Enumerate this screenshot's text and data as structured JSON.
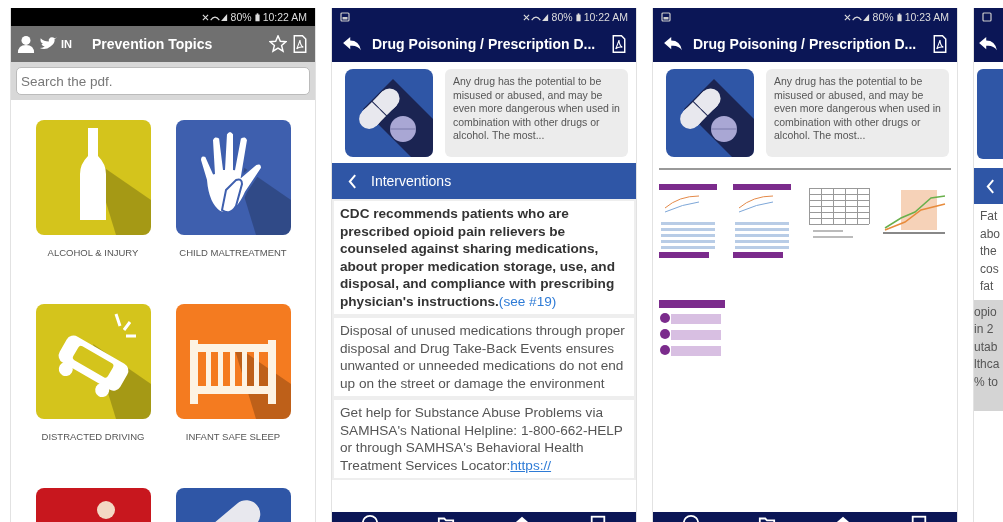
{
  "phones": [
    {
      "kind": "topics",
      "status": {
        "battery": "80%",
        "time": "10:22 AM"
      },
      "header": {
        "logo": "IN",
        "title": "Prevention Topics"
      },
      "search": {
        "placeholder": "Search the pdf."
      },
      "topics": [
        {
          "kind": "bottle",
          "color": "#d4c41c",
          "label": "ALCOHOL & INJURY"
        },
        {
          "kind": "hand",
          "color": "#3e5fae",
          "label": "CHILD MALTREATMENT"
        },
        {
          "kind": "car",
          "color": "#d4c41c",
          "label": "DISTRACTED DRIVING"
        },
        {
          "kind": "crib",
          "color": "#f47b20",
          "label": "INFANT SAFE SLEEP"
        },
        {
          "kind": "person",
          "color": "#c8171e"
        },
        {
          "kind": "pill",
          "color": "#2f56a6"
        }
      ]
    },
    {
      "kind": "interventions",
      "status": {
        "battery": "80%",
        "time": "10:22 AM"
      },
      "header": {
        "title": "Drug Poisoning / Prescription D..."
      },
      "summary": "Any drug has the potential to be misused or abused, and may be even more dangerous when used in combination with other drugs or alcohol. The most...",
      "section": "Interventions",
      "cards": [
        {
          "bold": true,
          "text": "CDC recommends patients who are prescribed opioid pain relievers be counseled against sharing medications, about proper medication storage, use, and disposal, and compliance with prescribing physician's instructions.",
          "link": "(see #19)"
        },
        {
          "bold": false,
          "text": "Disposal of unused medications through proper disposal and Drug Take-Back Events ensures unwanted or unneeded medications do not end up on the street or damage the environment"
        },
        {
          "bold": false,
          "text": "Get help for Substance Abuse Problems via SAMHSA's National Helpline: 1-800-662-HELP or through SAMHSA's Behavioral Health Treatment Services Locator:",
          "link": "https://"
        }
      ]
    },
    {
      "kind": "documents",
      "status": {
        "battery": "80%",
        "time": "10:23 AM"
      },
      "header": {
        "title": "Drug Poisoning / Prescription D..."
      },
      "summary": "Any drug has the potential to be misused or abused, and may be even more dangerous when used in combination with other drugs or alcohol. The most...",
      "thumbnails": [
        {
          "kind": "report"
        },
        {
          "kind": "report"
        },
        {
          "kind": "table"
        },
        {
          "kind": "chart"
        },
        {
          "kind": "infographic"
        }
      ]
    },
    {
      "kind": "partial",
      "lines": [
        "Fat",
        "abo",
        "the",
        "cos",
        "fat"
      ],
      "shaded_lines": [
        "opio",
        "in 2",
        "utab",
        "lthca",
        "% to"
      ]
    }
  ]
}
